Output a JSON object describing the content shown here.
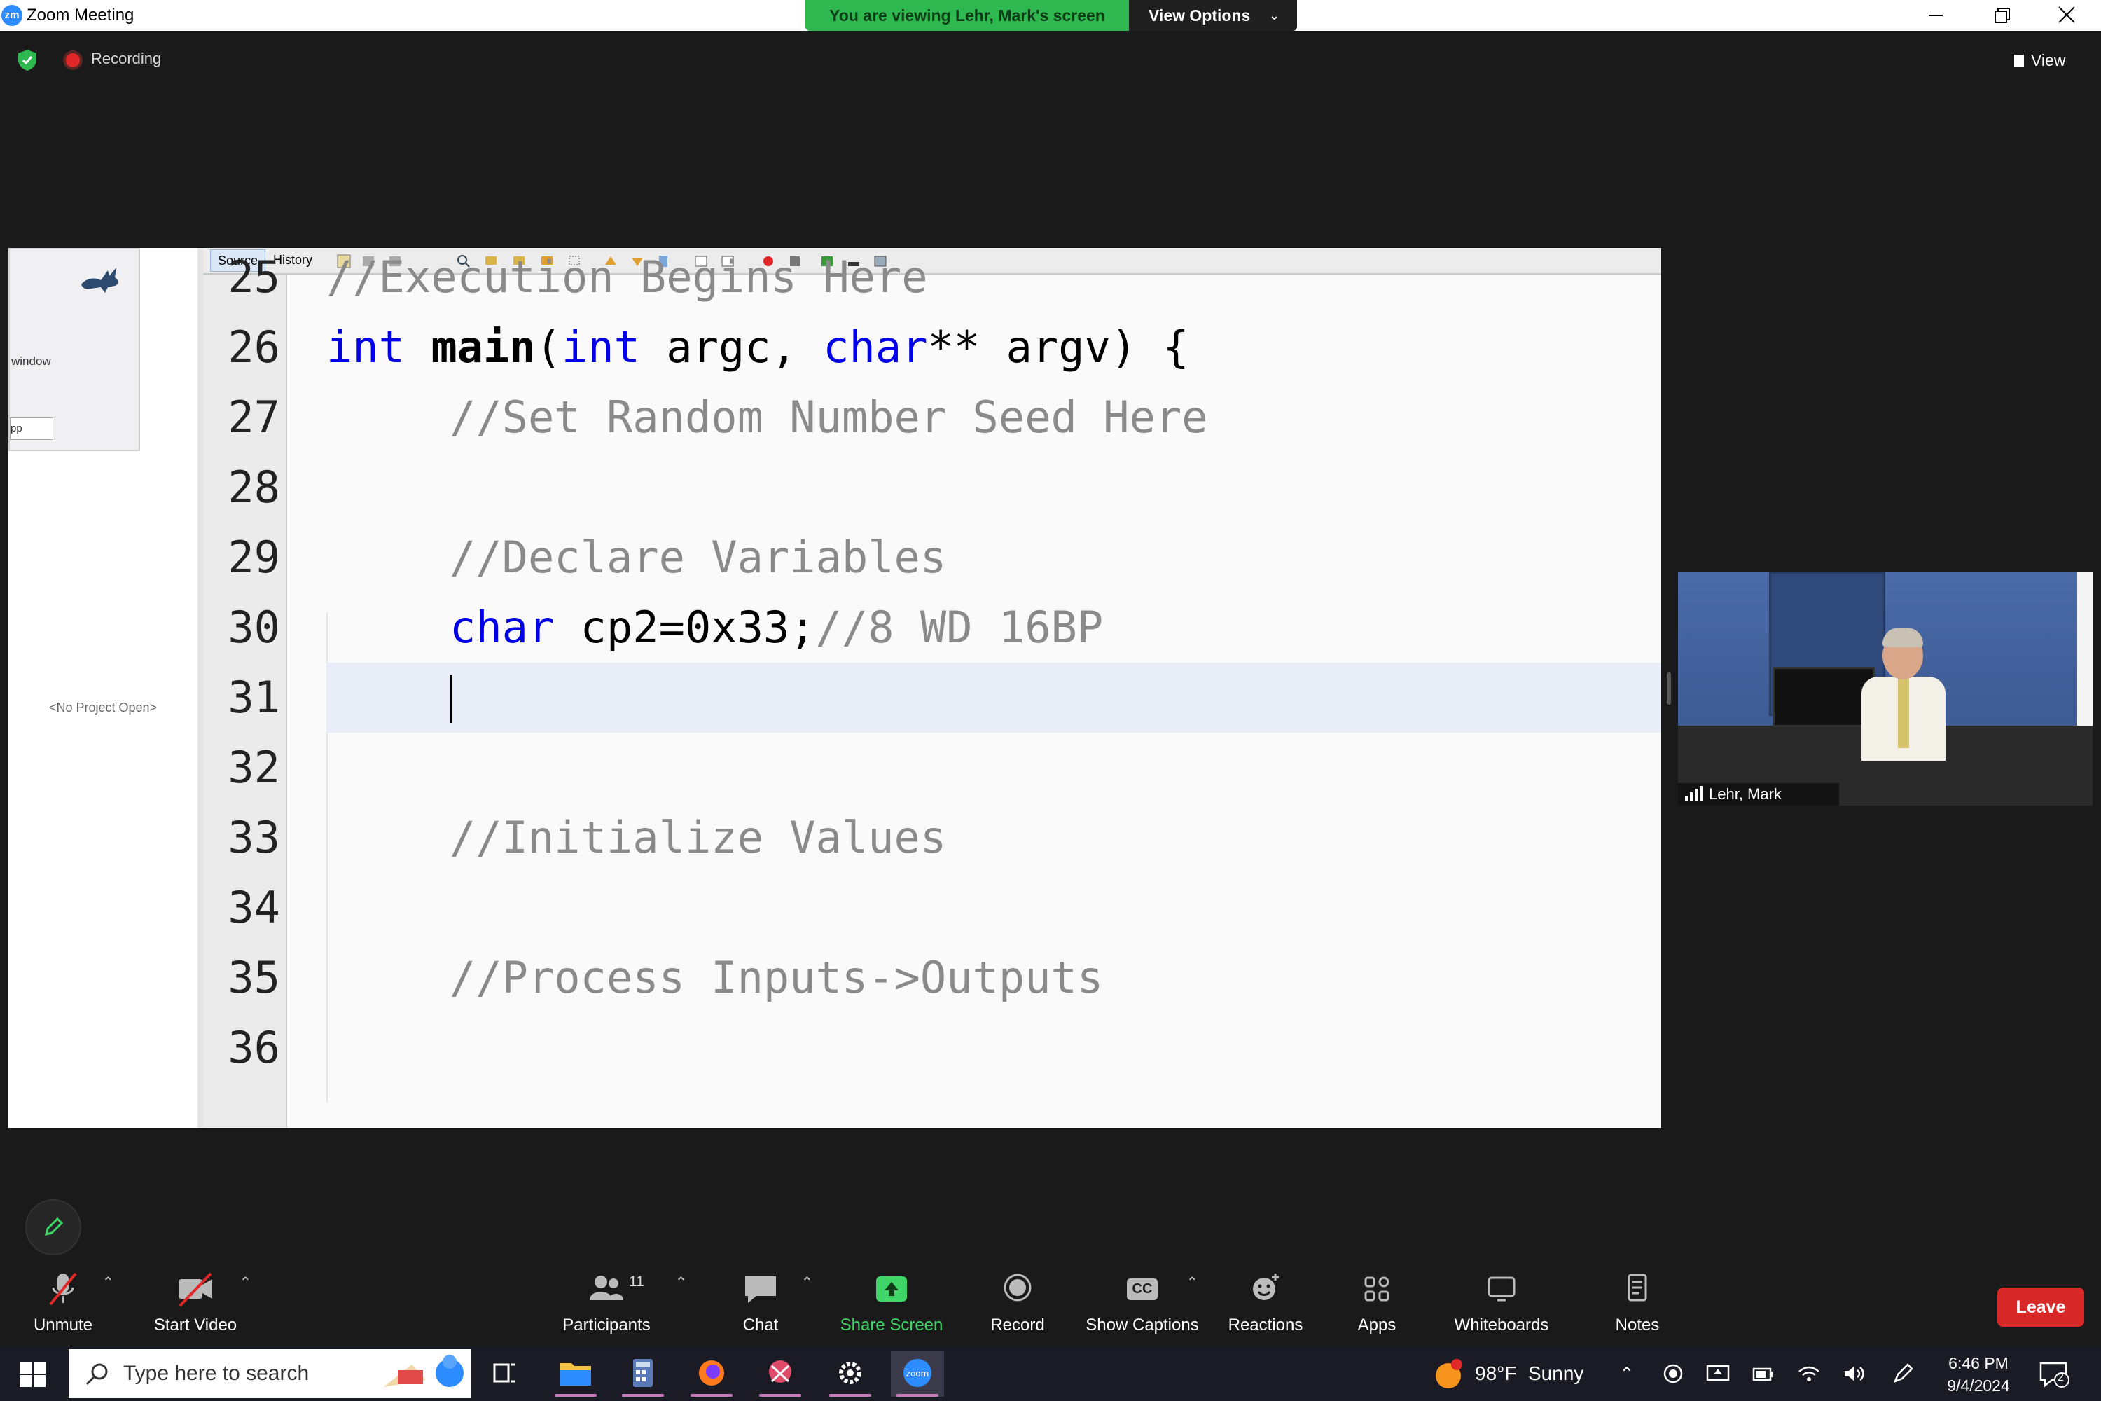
{
  "window": {
    "app_icon": "zm",
    "title": "Zoom Meeting",
    "minimize_icon": "minimize-icon",
    "restore_icon": "restore-icon",
    "close_icon": "close-icon"
  },
  "share_banner": {
    "viewing_text": "You are viewing Lehr, Mark's screen",
    "view_options_label": "View Options",
    "banner_color": "#2fb84f"
  },
  "meeting_status": {
    "recording_label": "Recording",
    "view_label": "View"
  },
  "shared_screen": {
    "left_panel": {
      "window_label": "window",
      "field_text": "pp",
      "no_project_text": "<No Project Open>"
    },
    "editor_tabs": [
      {
        "label": "Source",
        "active": true
      },
      {
        "label": "History",
        "active": false
      }
    ],
    "code_lines": [
      {
        "num": "25",
        "text": "//Execution Begins Here"
      },
      {
        "num": "26",
        "text": "int main(int argc, char** argv) {"
      },
      {
        "num": "27",
        "text": "//Set Random Number Seed Here"
      },
      {
        "num": "28",
        "text": ""
      },
      {
        "num": "29",
        "text": "//Declare Variables"
      },
      {
        "num": "30",
        "text": "char cp2=0x33;//8 WD 16BP"
      },
      {
        "num": "31",
        "text": ""
      },
      {
        "num": "32",
        "text": ""
      },
      {
        "num": "33",
        "text": "//Initialize Values"
      },
      {
        "num": "34",
        "text": ""
      },
      {
        "num": "35",
        "text": "//Process Inputs->Outputs"
      },
      {
        "num": "36",
        "text": ""
      }
    ],
    "code_tokens": {
      "l25": "//Execution Begins Here",
      "l26_kw1": "int",
      "l26_fn": "main",
      "l26_p1": "(",
      "l26_kw2": "int",
      "l26_p2": " argc, ",
      "l26_kw3": "char",
      "l26_p3": "** argv) {",
      "l27": "//Set Random Number Seed Here",
      "l29": "//Declare Variables",
      "l30_kw": "char",
      "l30_code": " cp2=0x33;",
      "l30_cm": "//8 WD 16BP",
      "l33": "//Initialize Values",
      "l35": "//Process Inputs->Outputs"
    },
    "current_line": "31",
    "colors": {
      "keyword": "#0000e6",
      "comment": "#8a8a8a",
      "current_line_bg": "#e8edf8"
    }
  },
  "video_tile": {
    "participant_name": "Lehr, Mark"
  },
  "toolbar": {
    "unmute": "Unmute",
    "start_video": "Start Video",
    "participants": "Participants",
    "participants_count": "11",
    "chat": "Chat",
    "share_screen": "Share Screen",
    "record": "Record",
    "show_captions": "Show Captions",
    "captions_badge": "CC",
    "reactions": "Reactions",
    "apps": "Apps",
    "whiteboards": "Whiteboards",
    "notes": "Notes",
    "leave": "Leave",
    "leave_color": "#d92828",
    "share_color": "#3fd667"
  },
  "taskbar": {
    "search_placeholder": "Type here to search",
    "weather_temp": "98°F",
    "weather_desc": "Sunny",
    "time": "6:46 PM",
    "date": "9/4/2024",
    "notification_count": "2",
    "zoom_app_label": "zoom"
  }
}
